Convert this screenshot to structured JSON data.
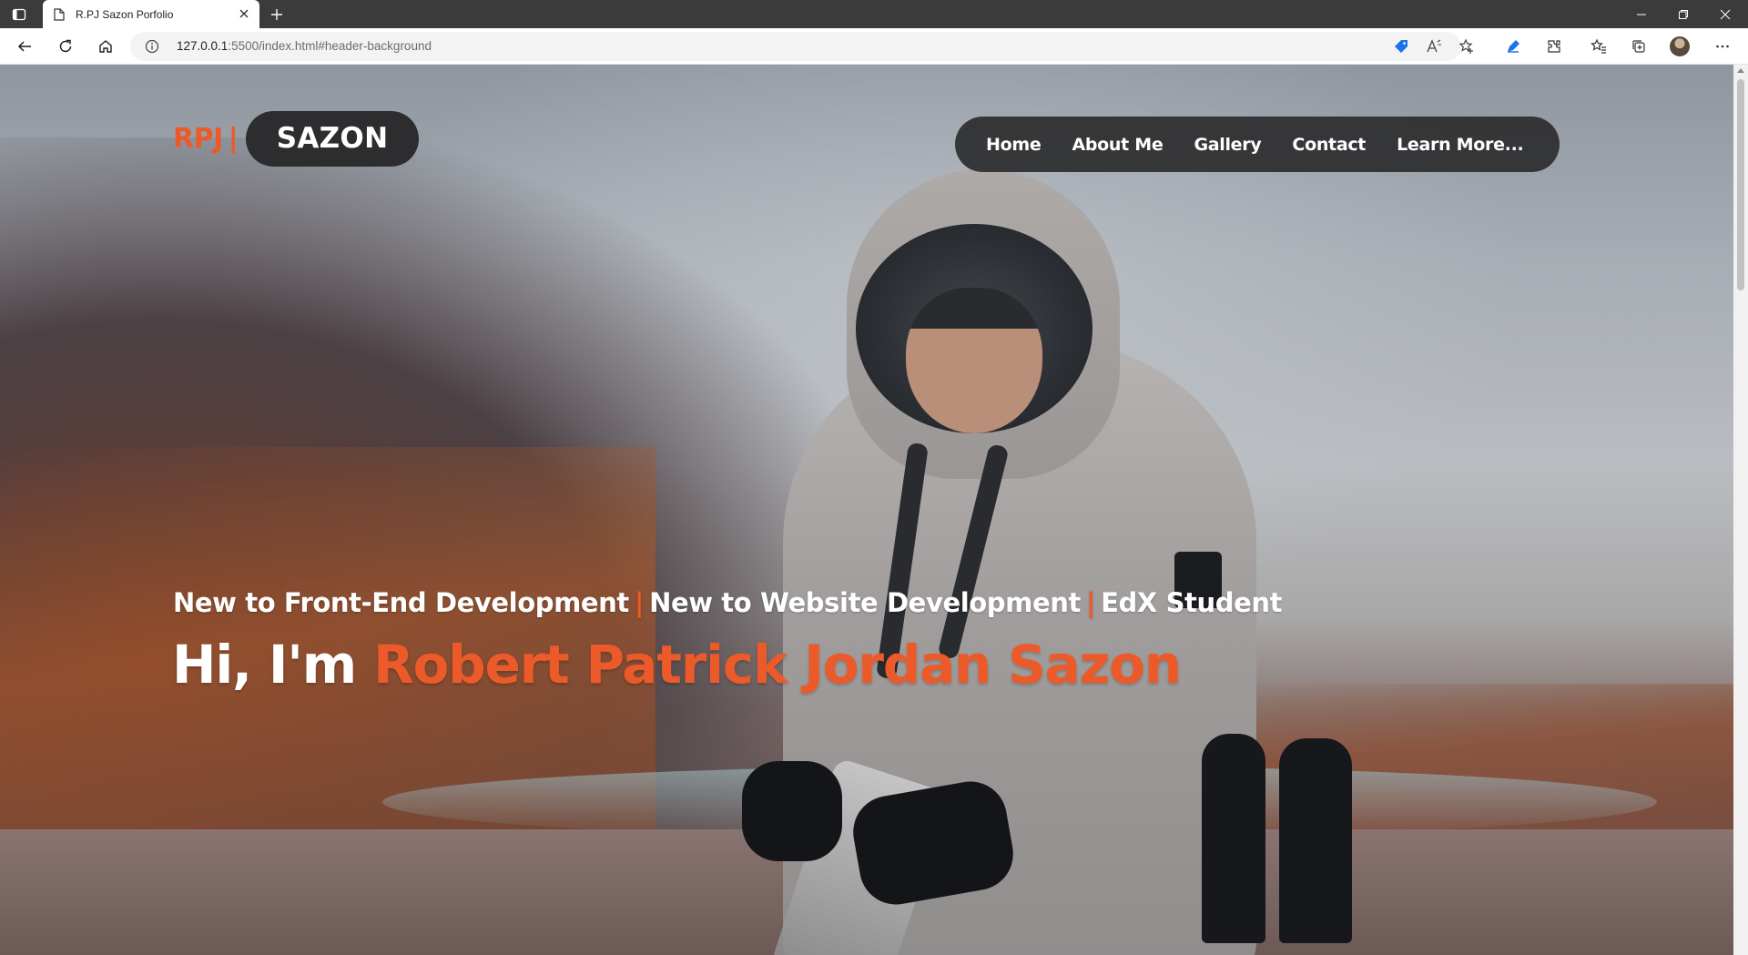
{
  "browser": {
    "tab_title": "R.PJ Sazon Porfolio",
    "url_host": "127.0.0.1",
    "url_rest": ":5500/index.html#header-background",
    "icons": [
      "tab-actions-icon",
      "page-icon",
      "close-icon",
      "plus-icon",
      "minimize-icon",
      "restore-icon",
      "close-window-icon",
      "back-arrow-icon",
      "refresh-icon",
      "home-icon",
      "info-icon",
      "tag-icon",
      "read-aloud-icon",
      "add-favorite-icon",
      "pen-icon",
      "extensions-icon",
      "favorites-icon",
      "collections-icon",
      "profile-avatar",
      "more-icon"
    ]
  },
  "site": {
    "logo": {
      "prefix": "RPJ",
      "separator": "|",
      "name": "SAZON"
    },
    "nav": {
      "home": "Home",
      "about": "About Me",
      "gallery": "Gallery",
      "contact": "Contact",
      "learn": "Learn More..."
    },
    "hero": {
      "sub_1": "New to Front-End Development",
      "sep_1": "|",
      "sub_2": "New to Website Development",
      "sep_2": "|",
      "sub_3": "EdX Student",
      "greeting": "Hi, I'm ",
      "name": "Robert Patrick Jordan Sazon"
    },
    "colors": {
      "accent": "#ec5a2a",
      "pill": "#2d2d2f"
    }
  }
}
